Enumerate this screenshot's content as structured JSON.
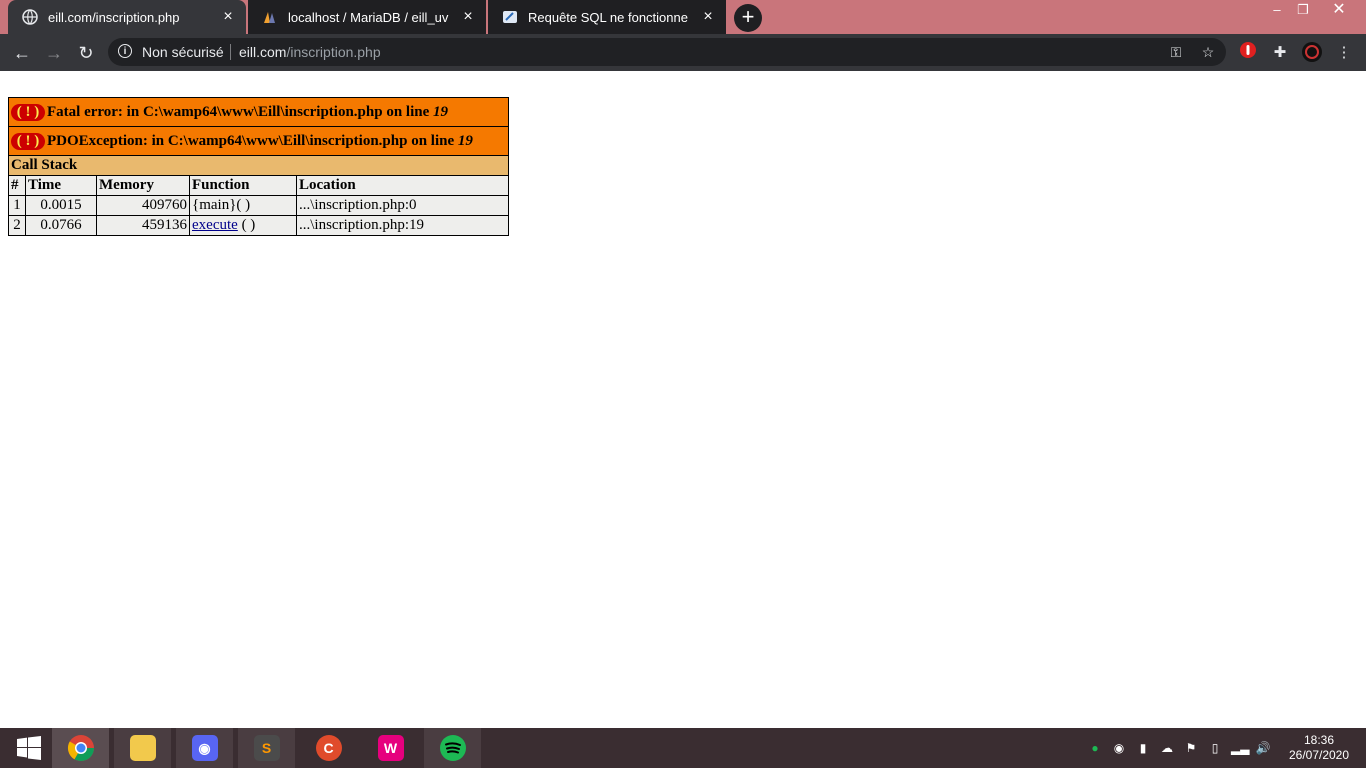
{
  "browser": {
    "tabs": [
      {
        "title": "eill.com/inscription.php",
        "favicon": "globe-icon",
        "active": true
      },
      {
        "title": "localhost / MariaDB / eill_uv | php",
        "favicon": "phpmyadmin-icon",
        "active": false
      },
      {
        "title": "Requête SQL ne fonctionne pas e",
        "favicon": "forum-icon",
        "active": false
      }
    ],
    "new_tab_label": "+",
    "security_label": "Non sécurisé",
    "url_host": "eill.com",
    "url_path": "/inscription.php"
  },
  "page": {
    "errors": [
      {
        "text": "Fatal error: in C:\\wamp64\\www\\Eill\\inscription.php on line ",
        "line": "19"
      },
      {
        "text": "PDOException: in C:\\wamp64\\www\\Eill\\inscription.php on line ",
        "line": "19"
      }
    ],
    "bang_symbol": "( ! )",
    "call_stack_title": "Call Stack",
    "columns": [
      "#",
      "Time",
      "Memory",
      "Function",
      "Location"
    ],
    "rows": [
      {
        "num": "1",
        "time": "0.0015",
        "memory": "409760",
        "function": "{main}( )",
        "location": "...\\inscription.php:0"
      },
      {
        "num": "2",
        "time": "0.0766",
        "memory": "459136",
        "function_link": "execute",
        "function_suffix": " ( )",
        "location": "...\\inscription.php:19"
      }
    ]
  },
  "taskbar": {
    "apps": [
      "windows-start",
      "chrome",
      "file-explorer",
      "discord",
      "sublime-text",
      "ccleaner",
      "wampserver",
      "spotify"
    ],
    "time": "18:36",
    "date": "26/07/2020"
  },
  "colors": {
    "error_bg": "#f57900",
    "callstack_bg": "#e9b96e",
    "cell_bg": "#eeeeec",
    "tabstrip_bg": "#c9757b",
    "toolbar_bg": "#35363a"
  }
}
